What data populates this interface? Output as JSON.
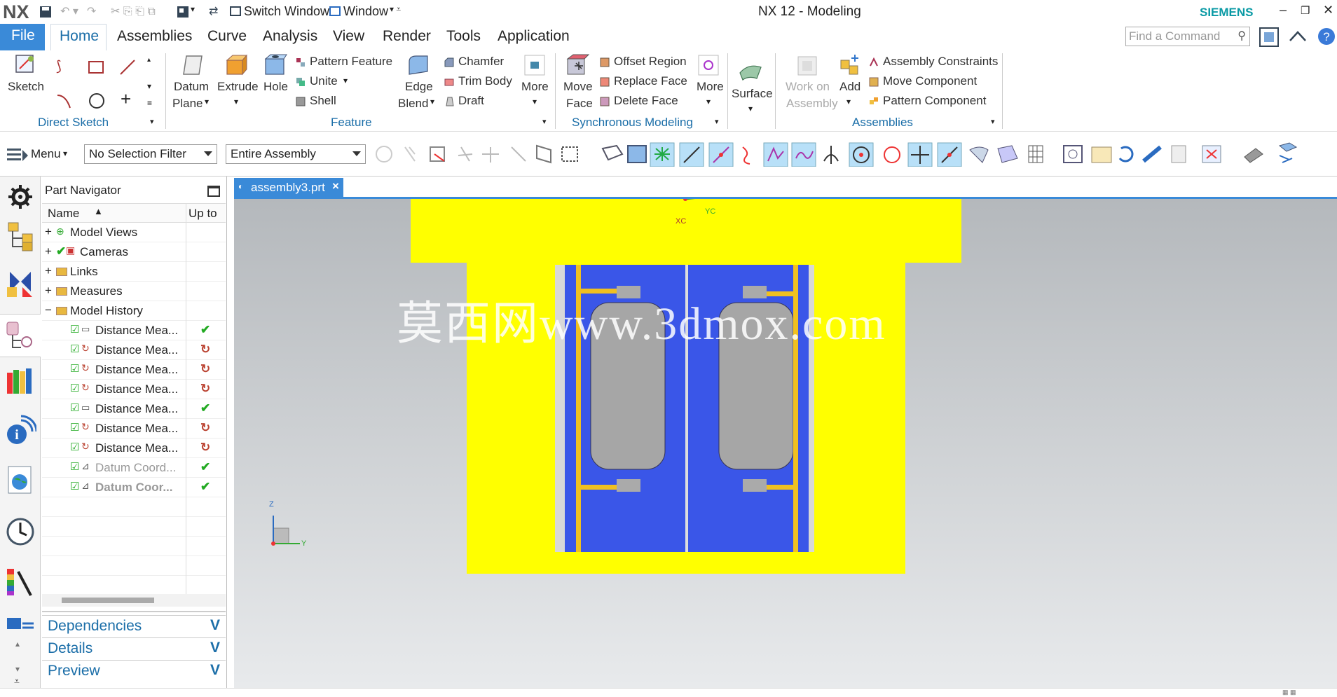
{
  "titlebar": {
    "logo": "NX",
    "switch_window": "Switch Window",
    "window_menu": "Window",
    "title": "NX 12 - Modeling",
    "brand": "SIEMENS",
    "colors": {
      "accent": "#3a8ad8",
      "brand": "#0a9aa5"
    }
  },
  "tabs": {
    "file": "File",
    "items": [
      "Home",
      "Assemblies",
      "Curve",
      "Analysis",
      "View",
      "Render",
      "Tools",
      "Application"
    ]
  },
  "find_command": {
    "placeholder": "Find a Command"
  },
  "ribbon": {
    "sketch": "Sketch",
    "direct_sketch": "Direct Sketch",
    "datum_plane": [
      "Datum",
      "Plane"
    ],
    "extrude": "Extrude",
    "hole": "Hole",
    "pattern_feature": "Pattern Feature",
    "unite": "Unite",
    "shell": "Shell",
    "edge_blend": [
      "Edge",
      "Blend"
    ],
    "chamfer": "Chamfer",
    "trim_body": "Trim Body",
    "draft": "Draft",
    "more": "More",
    "feature": "Feature",
    "move_face": [
      "Move",
      "Face"
    ],
    "offset_region": "Offset Region",
    "replace_face": "Replace Face",
    "delete_face": "Delete Face",
    "more2": "More",
    "sync_modeling": "Synchronous Modeling",
    "surface": "Surface",
    "work_on_assembly": [
      "Work on",
      "Assembly"
    ],
    "add": "Add",
    "assembly_constraints": "Assembly Constraints",
    "move_component": "Move Component",
    "pattern_component": "Pattern Component",
    "assemblies": "Assemblies"
  },
  "toolbar": {
    "menu": "Menu",
    "selection_filter": "No Selection Filter",
    "scope": "Entire Assembly"
  },
  "navigator": {
    "title": "Part Navigator",
    "col_name": "Name",
    "col_upto": "Up to",
    "rows": [
      {
        "label": "Model Views",
        "expander": "+"
      },
      {
        "label": "Cameras",
        "expander": "+"
      },
      {
        "label": "Links",
        "expander": "+"
      },
      {
        "label": "Measures",
        "expander": "+"
      },
      {
        "label": "Model History",
        "expander": "−"
      },
      {
        "label": "Distance Mea...",
        "status": "check"
      },
      {
        "label": "Distance Mea...",
        "status": "update"
      },
      {
        "label": "Distance Mea...",
        "status": "update"
      },
      {
        "label": "Distance Mea...",
        "status": "update"
      },
      {
        "label": "Distance Mea...",
        "status": "check"
      },
      {
        "label": "Distance Mea...",
        "status": "update"
      },
      {
        "label": "Distance Mea...",
        "status": "update"
      },
      {
        "label": "Datum Coord...",
        "status": "check"
      },
      {
        "label": "Datum Coor...",
        "status": "check"
      }
    ],
    "panels": [
      "Dependencies",
      "Details",
      "Preview"
    ]
  },
  "document_tab": {
    "label": "assembly3.prt",
    "close": "×"
  },
  "viewport": {
    "watermark": "莫西网www.3dmox.com",
    "xc": "XC",
    "yc": "YC",
    "axis_z": "Z",
    "axis_y": "Y",
    "colors": {
      "body": "#ffff00",
      "door": "#3a56e8",
      "glass": "#a6a6a6",
      "handle": "#f0c020"
    }
  }
}
